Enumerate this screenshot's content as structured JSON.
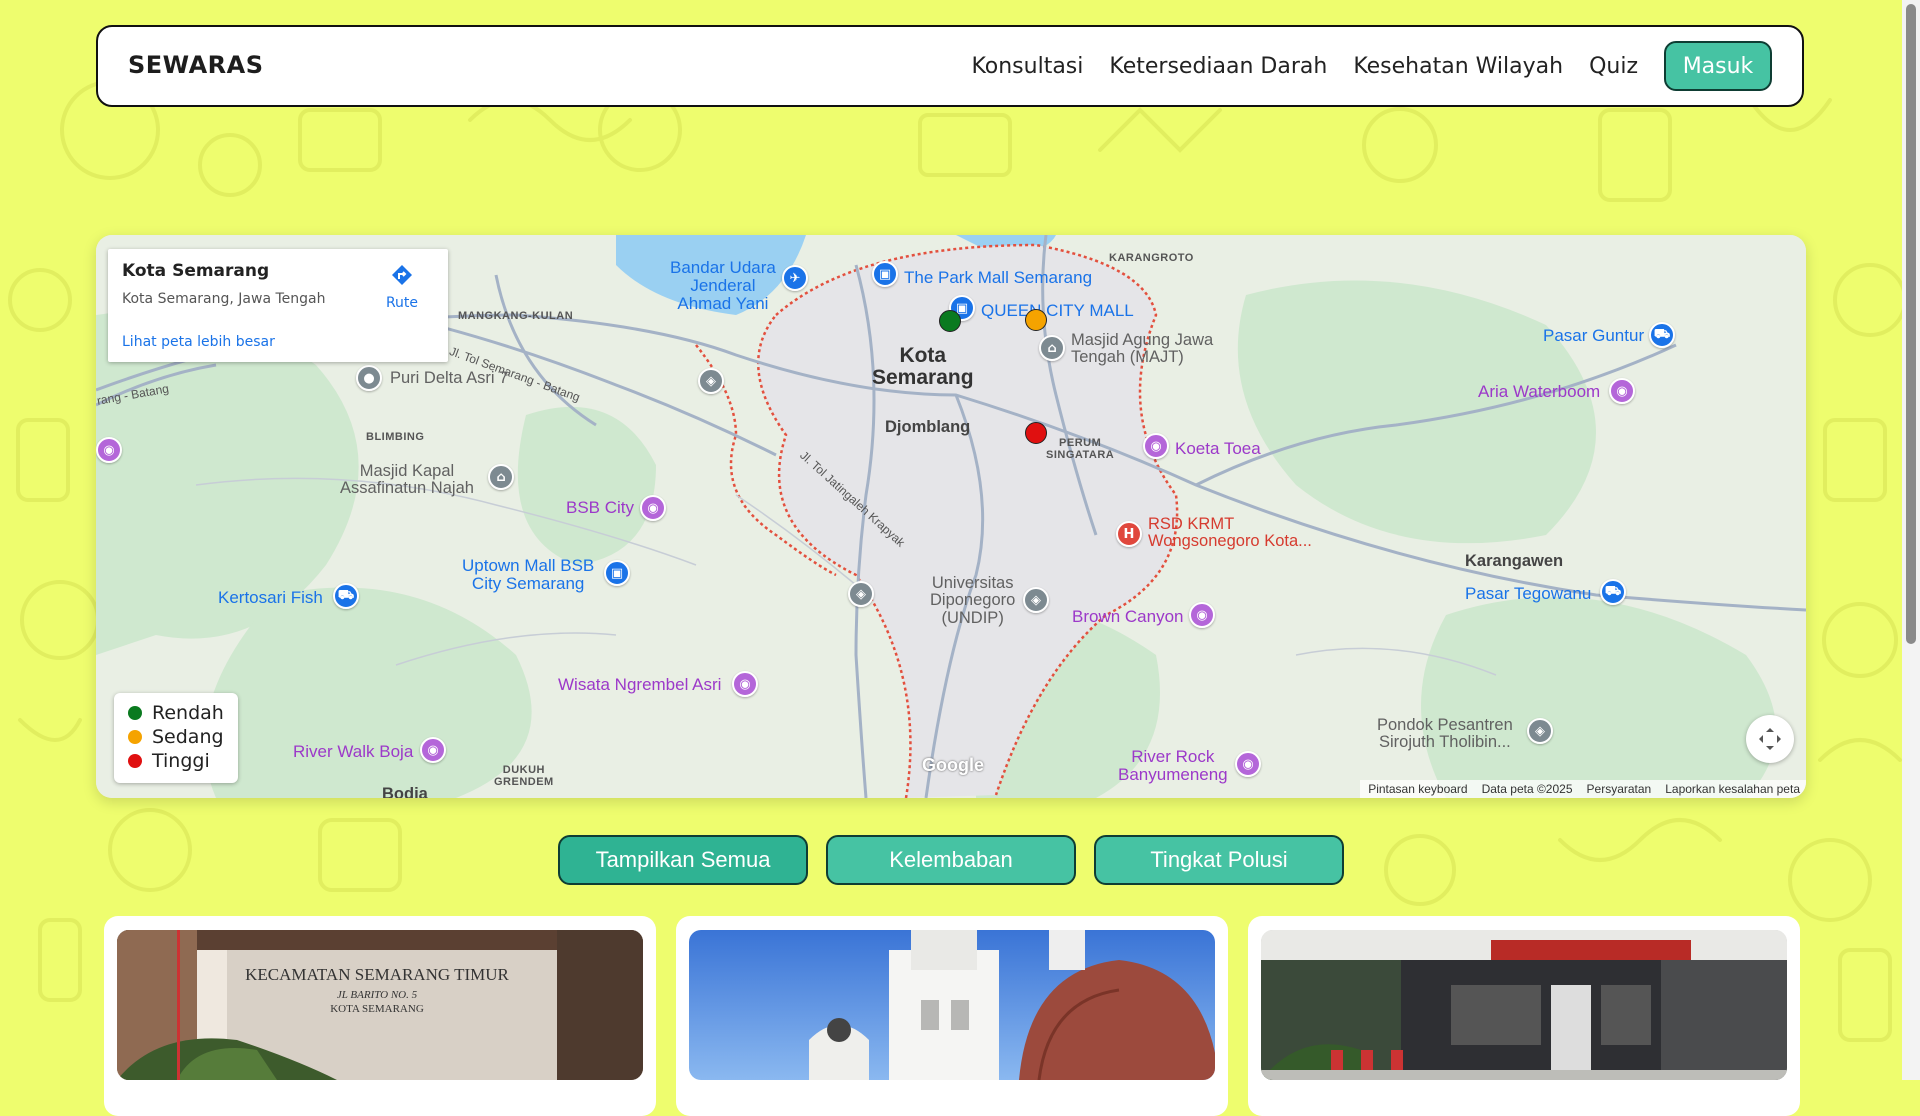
{
  "navbar": {
    "brand": "SEWARAS",
    "links": [
      "Konsultasi",
      "Ketersediaan Darah",
      "Kesehatan Wilayah",
      "Quiz"
    ],
    "login_label": "Masuk"
  },
  "map": {
    "place_card": {
      "title": "Kota Semarang",
      "address": "Kota Semarang, Jawa Tengah",
      "route_label": "Rute",
      "larger_map_link": "Lihat peta lebih besar"
    },
    "legend": [
      {
        "label": "Rendah",
        "color": "#0a7a1f"
      },
      {
        "label": "Sedang",
        "color": "#f5a300"
      },
      {
        "label": "Tinggi",
        "color": "#e01010"
      }
    ],
    "labels": {
      "city": "Kota\nSemarang",
      "djomblang": "Djomblang",
      "karangroto": "KARANGROTO",
      "mangkang": "MANGKANG-KULAN",
      "blimbing": "BLIMBING",
      "perum": "PERUM\nSINGATARA",
      "dukuh": "DUKUH\nGRENDEM",
      "bodja": "Bodja",
      "karangawen": "Karangawen",
      "airport": "Bandar Udara\nJenderal\nAhmad Yani",
      "park_mall": "The Park Mall Semarang",
      "queen_city": "QUEEN CITY MALL",
      "masjid_agung": "Masjid Agung Jawa\nTengah (MAJT)",
      "puri_delta": "Puri Delta Asri 7",
      "masjid_kapal": "Masjid Kapal\nAssafinatun Najah",
      "bsb_city": "BSB City",
      "uptown": "Uptown Mall BSB\nCity Semarang",
      "kertosari": "Kertosari Fish",
      "wisata": "Wisata Ngrembel Asri",
      "river_walk": "River Walk Boja",
      "koeta_toea": "Koeta Toea",
      "rsd": "RSD KRMT\nWongsonegoro Kota...",
      "undip": "Universitas\nDiponegoro\n(UNDIP)",
      "brown_canyon": "Brown Canyon",
      "pasar_guntur": "Pasar Guntur",
      "aria_waterboom": "Aria Waterboom",
      "pasar_tegowanu": "Pasar Tegowanu",
      "pondok": "Pondok Pesantren\nSirojuth Tholibin...",
      "river_rock": "River Rock\nBanyumeneng",
      "road1": "Jl. Tol Semarang - Batang",
      "road2": "rang - Batang",
      "road3": "Jl. Tol Jatingaleh Krapyak"
    },
    "markers": [
      {
        "level": "Rendah",
        "color": "#0a7a1f"
      },
      {
        "level": "Sedang",
        "color": "#f5a300"
      },
      {
        "level": "Tinggi",
        "color": "#e01010"
      }
    ],
    "attribution": [
      "Pintasan keyboard",
      "Data peta ©2025",
      "Persyaratan",
      "Laporkan kesalahan peta"
    ],
    "google_logo": "Google"
  },
  "filters": [
    "Tampilkan Semua",
    "Kelembaban",
    "Tingkat Polusi"
  ],
  "cards": [
    {
      "sign_line1": "KECAMATAN SEMARANG TIMUR",
      "sign_line2": "JL BARITO NO. 5",
      "sign_line3": "KOTA SEMARANG"
    },
    {},
    {}
  ],
  "colors": {
    "background": "#eefd6e",
    "accent": "#46c3a3"
  }
}
